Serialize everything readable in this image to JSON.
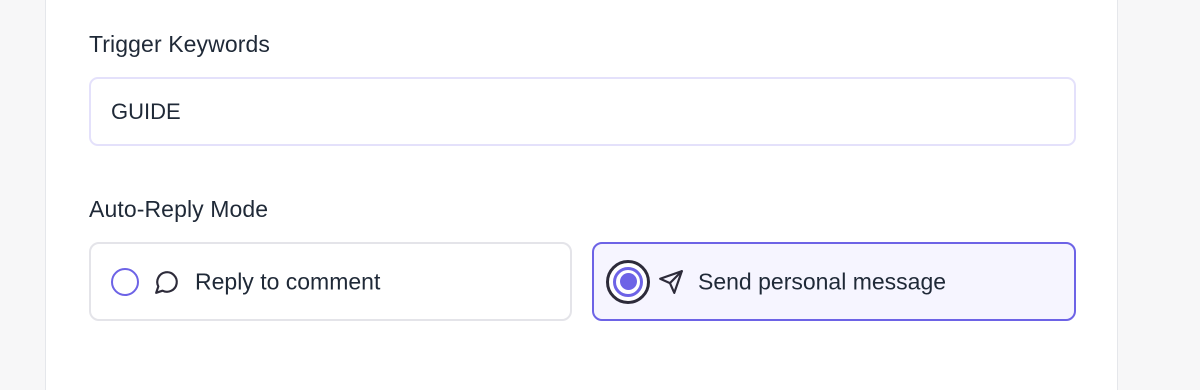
{
  "trigger_keywords": {
    "label": "Trigger Keywords",
    "value": "GUIDE"
  },
  "auto_reply_mode": {
    "label": "Auto-Reply Mode",
    "selected": "send_personal_message",
    "options": [
      {
        "id": "reply_to_comment",
        "label": "Reply to comment",
        "icon": "chat-bubble-icon"
      },
      {
        "id": "send_personal_message",
        "label": "Send personal message",
        "icon": "send-icon"
      }
    ]
  },
  "colors": {
    "accent": "#6d63e6",
    "selected_background": "#f6f5ff",
    "text": "#1f2937"
  }
}
